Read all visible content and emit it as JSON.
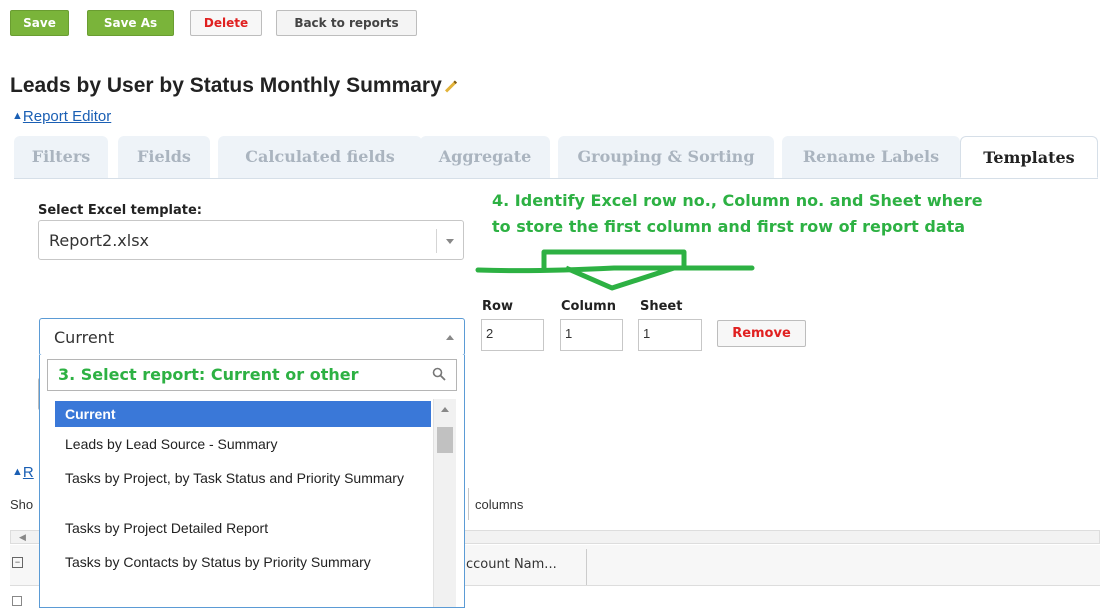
{
  "toolbar": {
    "save_label": "Save",
    "save_as_label": "Save As",
    "delete_label": "Delete",
    "back_label": "Back to reports"
  },
  "report": {
    "title": "Leads by User by Status Monthly Summary",
    "editor_link": "Report Editor",
    "collapsed_link_prefix": "R"
  },
  "tabs": [
    {
      "label": "Filters",
      "active": false
    },
    {
      "label": "Fields",
      "active": false
    },
    {
      "label": "Calculated fields",
      "active": false
    },
    {
      "label": "Aggregate",
      "active": false
    },
    {
      "label": "Grouping & Sorting",
      "active": false
    },
    {
      "label": "Rename Labels",
      "active": false
    },
    {
      "label": "Templates",
      "active": true
    }
  ],
  "templates": {
    "excel_label": "Select Excel template:",
    "excel_value": "Report2.xlsx",
    "report_select_value": "Current",
    "search_text": "3. Select report: Current or other",
    "row_header": "Row",
    "column_header": "Column",
    "sheet_header": "Sheet",
    "row_value": "2",
    "column_value": "1",
    "sheet_value": "1",
    "remove_label": "Remove"
  },
  "annotation": {
    "line1": "4. Identify Excel row no., Column no. and Sheet where",
    "line2": "to store the first column and first row of report data",
    "color": "#2db143"
  },
  "dropdown": {
    "items": [
      {
        "label": "Current",
        "selected": true
      },
      {
        "label": "Leads by Lead Source - Summary",
        "selected": false
      },
      {
        "label": "Tasks by Project, by Task Status and Priority Summary",
        "selected": false
      },
      {
        "label": "Tasks by Project Detailed Report",
        "selected": false
      },
      {
        "label": "Tasks by Contacts by Status by Priority Summary",
        "selected": false
      }
    ]
  },
  "background_table": {
    "show_prefix": "Sho",
    "columns_suffix": "columns",
    "account_header": "ccount Nam..."
  },
  "colors": {
    "accent_green": "#7ab43a",
    "selected_blue": "#3a78d8",
    "link_blue": "#1a5fb4",
    "delete_red": "#e02020"
  }
}
